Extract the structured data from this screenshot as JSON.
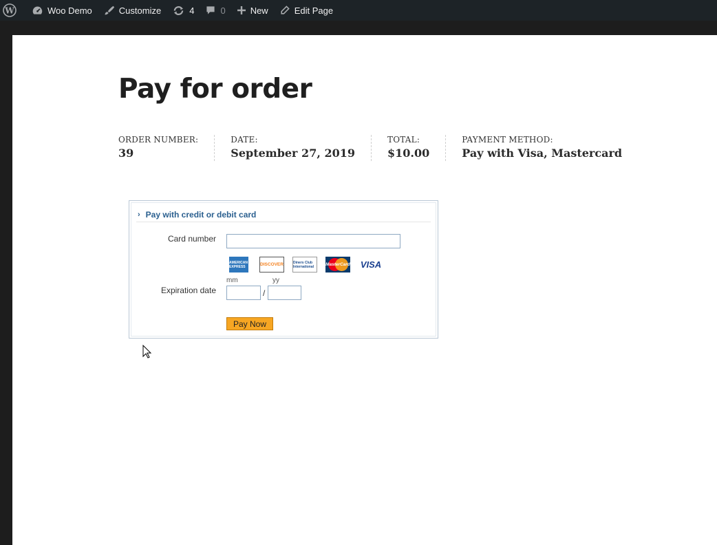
{
  "adminbar": {
    "site_name": "Woo Demo",
    "customize": "Customize",
    "updates_count": "4",
    "comments_count": "0",
    "new": "New",
    "edit_page": "Edit Page"
  },
  "page": {
    "title": "Pay for order"
  },
  "order_details": [
    {
      "label": "ORDER NUMBER:",
      "value": "39"
    },
    {
      "label": "DATE:",
      "value": "September 27, 2019"
    },
    {
      "label": "TOTAL:",
      "value": "$10.00"
    },
    {
      "label": "PAYMENT METHOD:",
      "value": "Pay with Visa, Mastercard"
    }
  ],
  "payment_form": {
    "header": "Pay with credit or debit card",
    "card_number_label": "Card number",
    "card_number_value": "",
    "cards": [
      {
        "icon": "amex-icon",
        "text": "AMERICAN EXPRESS"
      },
      {
        "icon": "discover-icon",
        "text": "DISCOVER"
      },
      {
        "icon": "diners-club-icon",
        "text": "Diners Club International"
      },
      {
        "icon": "mastercard-icon",
        "text": "MasterCard"
      },
      {
        "icon": "visa-icon",
        "text": "VISA"
      }
    ],
    "expiration_label": "Expiration date",
    "mm_label": "mm",
    "yy_label": "yy",
    "slash": "/",
    "mm_value": "",
    "yy_value": "",
    "pay_button": "Pay Now"
  },
  "colors": {
    "adminbar_bg": "#1d2327",
    "header_link": "#2a5f8f",
    "pay_button": "#f7a623"
  }
}
